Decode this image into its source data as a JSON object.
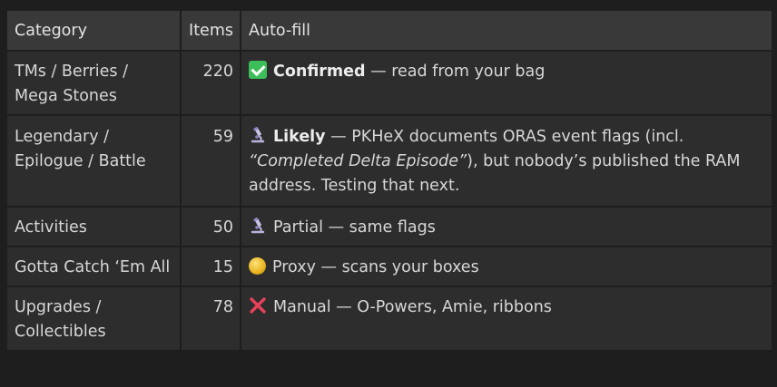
{
  "table": {
    "headers": {
      "category": "Category",
      "items": "Items",
      "autofill": "Auto-fill"
    },
    "colors": {
      "confirmed": "#3cbf5a",
      "proxy": "#e8b31f",
      "manual": "#e8415a"
    },
    "rows": [
      {
        "category": "TMs / Berries / Mega Stones",
        "items": "220",
        "icon": "check-icon",
        "status_bold": "Confirmed",
        "desc": " — read from your bag"
      },
      {
        "category": "Legendary / Epilogue / Battle",
        "items": "59",
        "icon": "microscope-icon",
        "status_bold": "Likely",
        "desc_a": " — PKHeX documents ORAS event flags (incl. ",
        "desc_quote": "“Completed Delta Episode”",
        "desc_b": "), but nobody’s published the RAM address. Testing that next."
      },
      {
        "category": "Activities",
        "items": "50",
        "icon": "microscope-icon",
        "status": "Partial",
        "desc": " — same flags"
      },
      {
        "category": "Gotta Catch ‘Em All",
        "items": "15",
        "icon": "coin-icon",
        "status": "Proxy",
        "desc": " — scans your boxes"
      },
      {
        "category": "Upgrades / Collectibles",
        "items": "78",
        "icon": "cross-icon",
        "status": "Manual",
        "desc": " — O-Powers, Amie, ribbons"
      }
    ]
  }
}
